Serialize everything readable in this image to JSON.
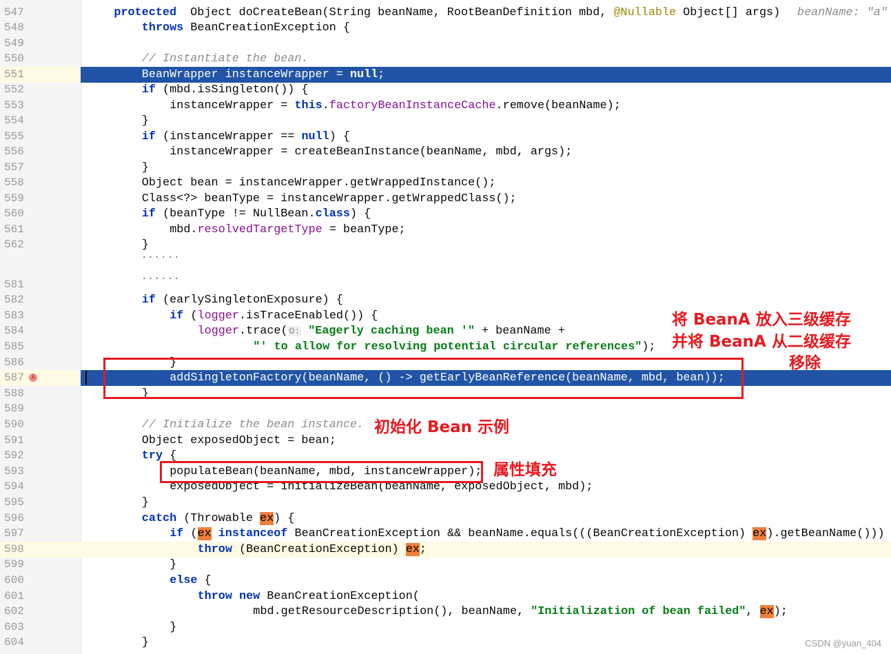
{
  "editor": {
    "lines": [
      {
        "num": "547",
        "indent": 4,
        "tokens": [
          [
            "kw",
            "protected"
          ],
          [
            "",
            "  Object doCreateBean(String beanName, RootBeanDefinition mbd, "
          ],
          [
            "ann",
            "@Nullable"
          ],
          [
            "",
            " Object[] args)"
          ]
        ],
        "hint": "beanName: \"a\""
      },
      {
        "num": "548",
        "indent": 8,
        "tokens": [
          [
            "kw",
            "throws"
          ],
          [
            "",
            " BeanCreationException {"
          ]
        ]
      },
      {
        "num": "549",
        "indent": 0,
        "tokens": []
      },
      {
        "num": "550",
        "indent": 8,
        "tokens": [
          [
            "cmt",
            "// Instantiate the bean."
          ]
        ]
      },
      {
        "num": "551",
        "indent": 8,
        "state": "selected",
        "tokens": [
          [
            "",
            "BeanWrapper instanceWrapper = "
          ],
          [
            "kw",
            "null"
          ],
          [
            "",
            ";"
          ]
        ]
      },
      {
        "num": "552",
        "indent": 8,
        "tokens": [
          [
            "kw",
            "if"
          ],
          [
            "",
            " (mbd.isSingleton()) {"
          ]
        ]
      },
      {
        "num": "553",
        "indent": 12,
        "tokens": [
          [
            "",
            "instanceWrapper = "
          ],
          [
            "kw",
            "this"
          ],
          [
            "",
            "."
          ],
          [
            "field",
            "factoryBeanInstanceCache"
          ],
          [
            "",
            ".remove(beanName);"
          ]
        ]
      },
      {
        "num": "554",
        "indent": 8,
        "tokens": [
          [
            "",
            "}"
          ]
        ]
      },
      {
        "num": "555",
        "indent": 8,
        "tokens": [
          [
            "kw",
            "if"
          ],
          [
            "",
            " (instanceWrapper == "
          ],
          [
            "kw",
            "null"
          ],
          [
            "",
            ") {"
          ]
        ]
      },
      {
        "num": "556",
        "indent": 12,
        "tokens": [
          [
            "",
            "instanceWrapper = createBeanInstance(beanName, mbd, args);"
          ]
        ]
      },
      {
        "num": "557",
        "indent": 8,
        "tokens": [
          [
            "",
            "}"
          ]
        ]
      },
      {
        "num": "558",
        "indent": 8,
        "tokens": [
          [
            "",
            "Object bean = instanceWrapper.getWrappedInstance();"
          ]
        ]
      },
      {
        "num": "559",
        "indent": 8,
        "tokens": [
          [
            "",
            "Class<?> beanType = instanceWrapper.getWrappedClass();"
          ]
        ]
      },
      {
        "num": "560",
        "indent": 8,
        "tokens": [
          [
            "kw",
            "if"
          ],
          [
            "",
            " (beanType != NullBean."
          ],
          [
            "kw",
            "class"
          ],
          [
            "",
            ") {"
          ]
        ]
      },
      {
        "num": "561",
        "indent": 12,
        "tokens": [
          [
            "",
            "mbd."
          ],
          [
            "field",
            "resolvedTargetType"
          ],
          [
            "",
            " = beanType;"
          ]
        ]
      },
      {
        "num": "562",
        "indent": 8,
        "tokens": [
          [
            "",
            "}"
          ]
        ]
      },
      {
        "num": "581",
        "indent": 0,
        "tokens": []
      },
      {
        "num": "582",
        "indent": 8,
        "tokens": [
          [
            "kw",
            "if"
          ],
          [
            "",
            " (earlySingletonExposure) {"
          ]
        ]
      },
      {
        "num": "583",
        "indent": 12,
        "tokens": [
          [
            "kw",
            "if"
          ],
          [
            "",
            " ("
          ],
          [
            "field",
            "logger"
          ],
          [
            "",
            ".isTraceEnabled()) {"
          ]
        ]
      },
      {
        "num": "584",
        "indent": 16,
        "tokens": [
          [
            "field",
            "logger"
          ],
          [
            "",
            ".trace("
          ],
          [
            "phint",
            "O:"
          ],
          [
            "",
            " "
          ],
          [
            "str",
            "\"Eagerly caching bean '\""
          ],
          [
            "",
            " + beanName +"
          ]
        ]
      },
      {
        "num": "585",
        "indent": 24,
        "tokens": [
          [
            "str",
            "\"' to allow for resolving potential circular references\""
          ],
          [
            "",
            ");"
          ]
        ]
      },
      {
        "num": "586",
        "indent": 12,
        "tokens": [
          [
            "",
            "}"
          ]
        ]
      },
      {
        "num": "587",
        "indent": 12,
        "state": "selected",
        "tokens": [
          [
            "",
            "addSingletonFactory(beanName, () -> getEarlyBeanReference(beanName, mbd, bean));"
          ]
        ]
      },
      {
        "num": "588",
        "indent": 8,
        "tokens": [
          [
            "",
            "}"
          ]
        ]
      },
      {
        "num": "589",
        "indent": 0,
        "tokens": []
      },
      {
        "num": "590",
        "indent": 8,
        "tokens": [
          [
            "cmt",
            "// Initialize the bean instance."
          ]
        ]
      },
      {
        "num": "591",
        "indent": 8,
        "tokens": [
          [
            "",
            "Object exposedObject = bean;"
          ]
        ]
      },
      {
        "num": "592",
        "indent": 8,
        "tokens": [
          [
            "kw",
            "try"
          ],
          [
            "",
            " {"
          ]
        ]
      },
      {
        "num": "593",
        "indent": 12,
        "tokens": [
          [
            "",
            "populateBean(beanName, mbd, instanceWrapper);"
          ]
        ]
      },
      {
        "num": "594",
        "indent": 12,
        "tokens": [
          [
            "",
            "exposedObject = initializeBean(beanName, exposedObject, mbd);"
          ]
        ]
      },
      {
        "num": "595",
        "indent": 8,
        "tokens": [
          [
            "",
            "}"
          ]
        ]
      },
      {
        "num": "596",
        "indent": 8,
        "tokens": [
          [
            "kw",
            "catch"
          ],
          [
            "",
            " (Throwable "
          ],
          [
            "ex",
            "ex"
          ],
          [
            "",
            ") {"
          ]
        ]
      },
      {
        "num": "597",
        "indent": 12,
        "tokens": [
          [
            "kw",
            "if"
          ],
          [
            "",
            " ("
          ],
          [
            "ex",
            "ex"
          ],
          [
            "",
            " "
          ],
          [
            "kw",
            "instanceof"
          ],
          [
            "",
            " BeanCreationException && beanName.equals(((BeanCreationException) "
          ],
          [
            "ex",
            "ex"
          ],
          [
            "",
            ").getBeanName()))"
          ]
        ]
      },
      {
        "num": "598",
        "indent": 16,
        "state": "current",
        "tokens": [
          [
            "kw",
            "throw"
          ],
          [
            "",
            " (BeanCreationException) "
          ],
          [
            "ex",
            "ex"
          ],
          [
            "",
            ";"
          ]
        ]
      },
      {
        "num": "599",
        "indent": 12,
        "tokens": [
          [
            "",
            "}"
          ]
        ]
      },
      {
        "num": "600",
        "indent": 12,
        "tokens": [
          [
            "kw",
            "else"
          ],
          [
            "",
            " {"
          ]
        ]
      },
      {
        "num": "601",
        "indent": 16,
        "tokens": [
          [
            "kw",
            "throw"
          ],
          [
            "",
            " "
          ],
          [
            "kw",
            "new"
          ],
          [
            "",
            " BeanCreationException("
          ]
        ]
      },
      {
        "num": "602",
        "indent": 24,
        "tokens": [
          [
            "",
            "mbd.getResourceDescription(), beanName, "
          ],
          [
            "str",
            "\"Initialization of bean failed\""
          ],
          [
            "",
            ", "
          ],
          [
            "ex",
            "ex"
          ],
          [
            "",
            ");"
          ]
        ]
      },
      {
        "num": "603",
        "indent": 12,
        "tokens": [
          [
            "",
            "}"
          ]
        ]
      },
      {
        "num": "604",
        "indent": 8,
        "tokens": [
          [
            "",
            "}"
          ]
        ]
      }
    ],
    "folded_marker_1": "······",
    "folded_marker_2": "······"
  },
  "annotations": {
    "note_cache_line1": "将 BeanA 放入三级缓存",
    "note_cache_line2": "并将 BeanA 从二级缓存",
    "note_cache_line3": "移除",
    "note_init": "初始化 Bean 示例",
    "note_populate": "属性填充",
    "color": "#e8191f"
  },
  "watermark": "CSDN @yuan_404",
  "colors": {
    "selection": "#2154a6",
    "current_line": "#fffae3",
    "keyword": "#0033b3",
    "string": "#067d17",
    "field": "#871094"
  }
}
